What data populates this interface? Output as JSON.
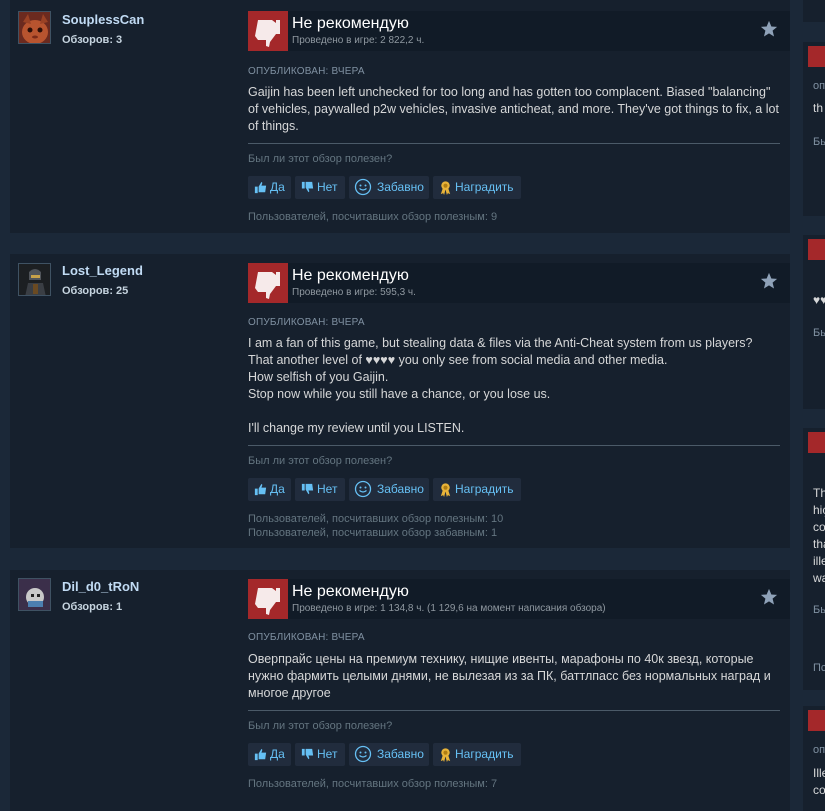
{
  "reviews": [
    {
      "author": "SouplessCan",
      "reviews_count": "Обзоров: 3",
      "verdict": "Не рекомендую",
      "hours": "Проведено в игре: 2 822,2 ч.",
      "posted": "ОПУБЛИКОВАН: ВЧЕРА",
      "text": "Gaijin has been left unchecked for too long and has gotten too complacent. Biased \"balancing\" of vehicles, paywalled p2w vehicles, invasive anticheat, and more. They've got things to fix, a lot of things.",
      "helpful_question": "Был ли этот обзор полезен?",
      "stats": [
        "Пользователей, посчитавших обзор полезным: 9"
      ]
    },
    {
      "author": "Lost_Legend",
      "reviews_count": "Обзоров: 25",
      "verdict": "Не рекомендую",
      "hours": "Проведено в игре: 595,3 ч.",
      "posted": "ОПУБЛИКОВАН: ВЧЕРА",
      "text": "I am a fan of this game, but stealing data & files via the Anti-Cheat system from us players?\nThat another level of ♥♥♥♥ you only see from social media and other media.\nHow selfish of you Gaijin.\nStop now while you still have a chance, or you lose us.\n\nI'll change my review until you LISTEN.",
      "helpful_question": "Был ли этот обзор полезен?",
      "stats": [
        "Пользователей, посчитавших обзор полезным: 10",
        "Пользователей, посчитавших обзор забавным: 1"
      ]
    },
    {
      "author": "Dil_d0_tRoN",
      "reviews_count": "Обзоров: 1",
      "verdict": "Не рекомендую",
      "hours": "Проведено в игре: 1 134,8 ч. (1 129,6 на момент написания обзора)",
      "posted": "ОПУБЛИКОВАН: ВЧЕРА",
      "text": "Оверпрайс цены на премиум технику, нищие ивенты, марафоны по 40к звезд, которые нужно фармить целыми днями, не вылезая из за ПК, баттлпасс без нормальных наград и многое другое",
      "helpful_question": "Был ли этот обзор полезен?",
      "stats": [
        "Пользователей, посчитавших обзор полезным: 7"
      ]
    }
  ],
  "buttons": {
    "yes": "Да",
    "no": "Нет",
    "funny": "Забавно",
    "award": "Наградить"
  },
  "side_column": {
    "snippets": [
      "оп",
      "th",
      "Бь",
      "♥♥",
      "Бь",
      "Th",
      "hiç",
      "co",
      "tha",
      "ille",
      "wa",
      "Бь",
      "Пс",
      "оп",
      "Ille",
      "co"
    ]
  },
  "colors": {
    "background": "#1b2838",
    "card": "#16202d",
    "link": "#66c0f4",
    "not_recommended": "#a4282a"
  }
}
